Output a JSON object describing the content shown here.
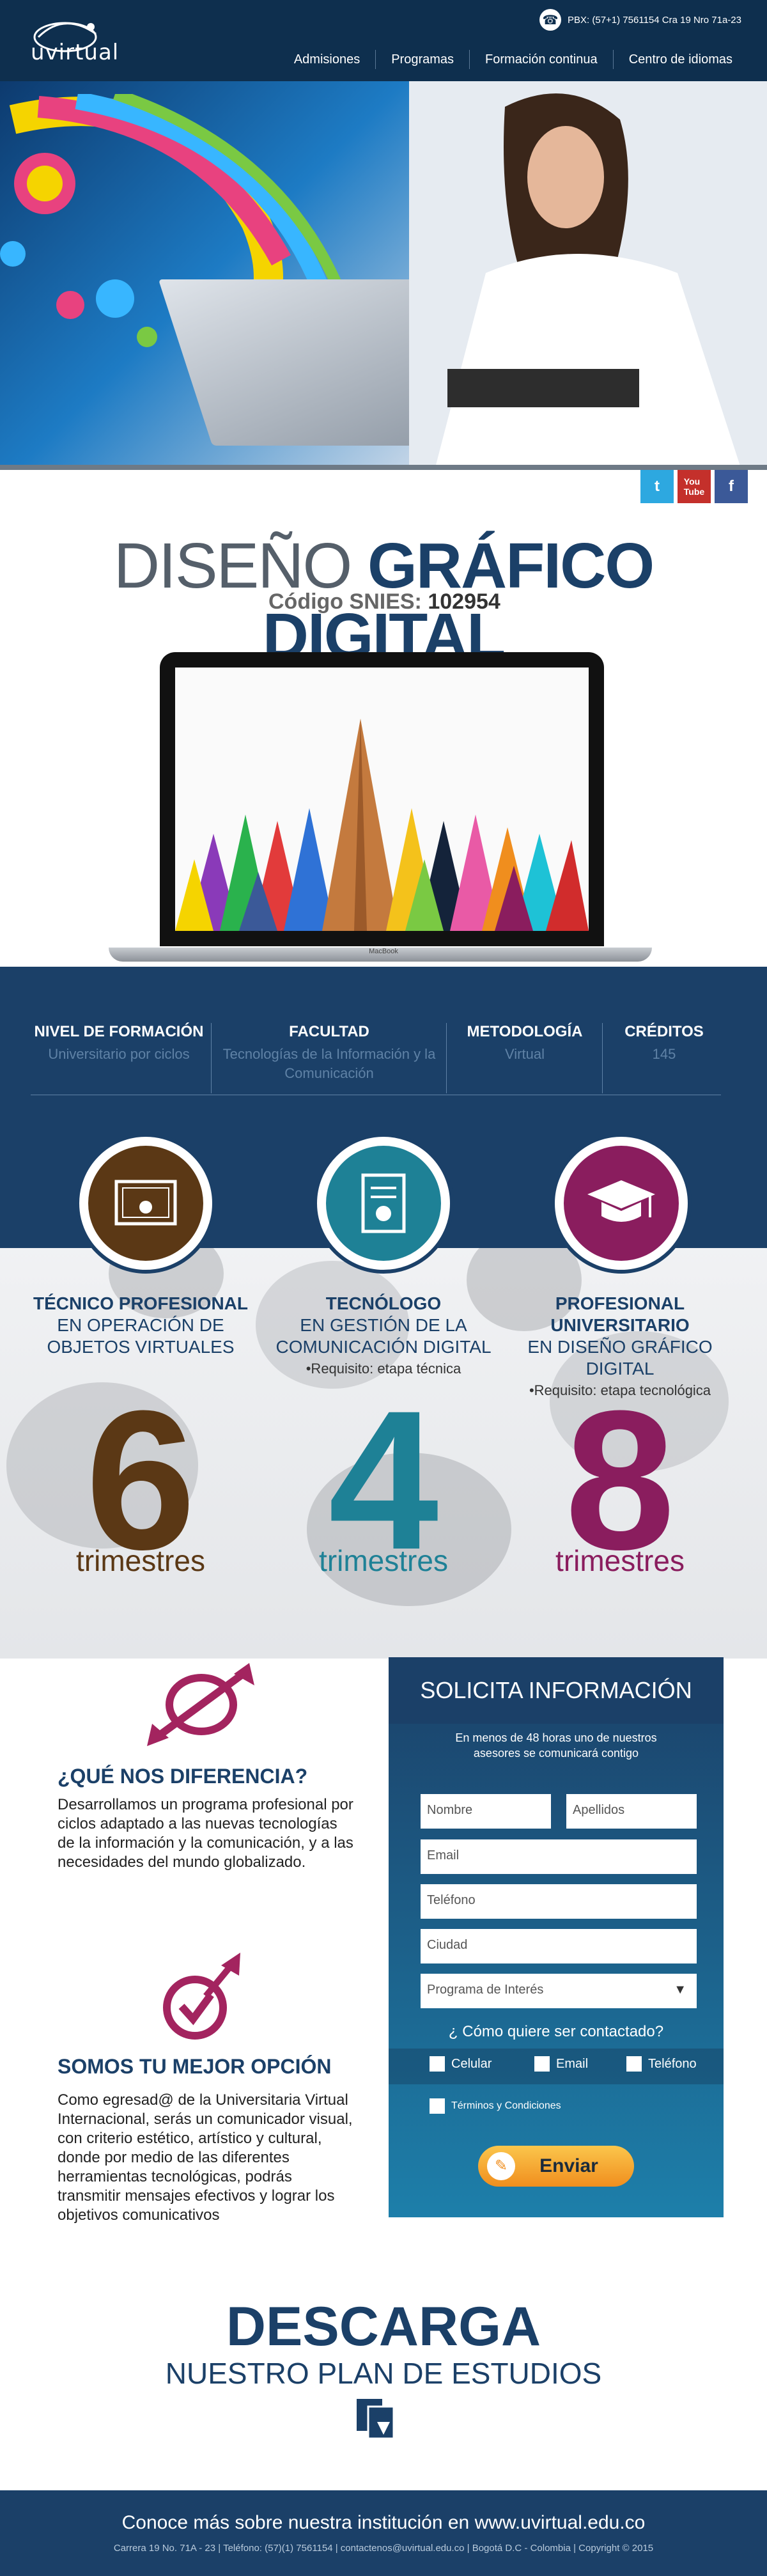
{
  "header": {
    "logo": "uvirtual",
    "contact": "PBX: (57+1) 7561154   Cra 19 Nro 71a-23",
    "nav": [
      "Admisiones",
      "Programas",
      "Formación continua",
      "Centro de idiomas"
    ]
  },
  "social": [
    "twitter-icon",
    "youtube-icon",
    "facebook-icon"
  ],
  "title": {
    "light": "DISEÑO",
    "bold": "GRÁFICO DIGITAL"
  },
  "snies": {
    "label": "Código SNIES:",
    "code": "102954"
  },
  "macbook_label": "MacBook",
  "info": [
    {
      "head": "NIVEL DE FORMACIÓN",
      "value": "Universitario por ciclos"
    },
    {
      "head": "FACULTAD",
      "value": "Tecnologías de la Información y la Comunicación"
    },
    {
      "head": "METODOLOGÍA",
      "value": "Virtual"
    },
    {
      "head": "CRÉDITOS",
      "value": "145"
    }
  ],
  "degrees": [
    {
      "title": "TÉCNICO PROFESIONAL",
      "sub": "EN OPERACIÓN DE OBJETOS VIRTUALES",
      "req": "",
      "number": "6",
      "unit": "trimestres",
      "color": "#5b3815"
    },
    {
      "title": "TECNÓLOGO",
      "sub": "EN GESTIÓN DE LA COMUNICACIÓN DIGITAL",
      "req": "•Requisito: etapa técnica",
      "number": "4",
      "unit": "trimestres",
      "color": "#1e8196"
    },
    {
      "title": "PROFESIONAL UNIVERSITARIO",
      "sub": "EN DISEÑO GRÁFICO DIGITAL",
      "req": "•Requisito: etapa tecnológica",
      "number": "8",
      "unit": "trimestres",
      "color": "#8a1d5e"
    }
  ],
  "diff": {
    "heading": "¿QUÉ NOS DIFERENCIA?",
    "text": "Desarrollamos un programa profesional por ciclos adaptado a las nuevas tecnologías de la información y la comunicación, y a las necesidades del mundo globalizado."
  },
  "best": {
    "heading": "SOMOS TU MEJOR OPCIÓN",
    "text": "Como egresad@ de la Universitaria Virtual Internacional, serás un comunicador visual, con criterio estético, artístico y cultural, donde por medio de las diferentes herramientas tecnológicas, podrás transmitir mensajes efectivos y lograr los objetivos comunicativos"
  },
  "form": {
    "title": "SOLICITA INFORMACIÓN",
    "subtitle": "En menos de 48 horas uno de nuestros asesores se comunicará contigo",
    "nombre": "Nombre",
    "apellidos": "Apellidos",
    "email": "Email",
    "telefono": "Teléfono",
    "ciudad": "Ciudad",
    "programa": "Programa de Interés",
    "question": "¿ Cómo quiere ser contactado?",
    "opt_celular": "Celular",
    "opt_email": "Email",
    "opt_telefono": "Teléfono",
    "terms": "Términos y Condiciones",
    "send": "Enviar"
  },
  "download": {
    "heading": "DESCARGA",
    "sub": "NUESTRO PLAN DE ESTUDIOS"
  },
  "footer": {
    "heading": "Conoce más sobre nuestra institución en www.uvirtual.edu.co",
    "details": "Carrera 19 No. 71A - 23   |   Teléfono: (57)(1) 7561154   |   contactenos@uvirtual.edu.co   |   Bogotá D.C - Colombia   |   Copyright © 2015"
  }
}
